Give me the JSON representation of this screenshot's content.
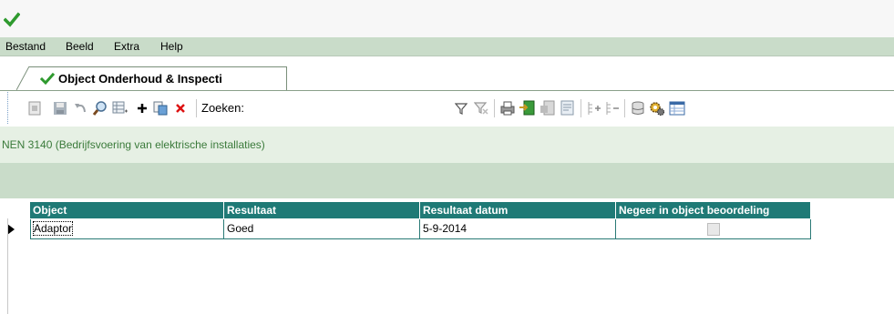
{
  "menu": {
    "items": [
      "Bestand",
      "Beeld",
      "Extra",
      "Help"
    ]
  },
  "tab": {
    "label": "Object Onderhoud & Inspecti"
  },
  "toolbar": {
    "search_label": "Zoeken:",
    "search_value": ""
  },
  "section": {
    "title": "NEN 3140 (Bedrijfsvoering van elektrische installaties)"
  },
  "grid": {
    "columns": [
      "Object",
      "Resultaat",
      "Resultaat datum",
      "Negeer in object beoordeling"
    ],
    "rows": [
      {
        "object": "Adaptor",
        "resultaat": "Goed",
        "datum": "5-9-2014",
        "negeer": false
      }
    ]
  },
  "icons": {
    "app": "green-check-logo-icon",
    "toolbar": [
      "new-record-icon",
      "save-icon",
      "undo-icon",
      "search-icon",
      "grid-export-icon",
      "add-icon",
      "copy-icon",
      "delete-icon",
      "filter-icon",
      "clear-filter-icon",
      "print-icon",
      "import-icon",
      "export-icon",
      "report-icon",
      "expand-icon",
      "collapse-icon",
      "database-icon",
      "settings-gear-icon",
      "table-icon"
    ]
  },
  "colors": {
    "menu_bg": "#c9dcc9",
    "grid_header": "#1f7a76",
    "section_text": "#3a7a3a",
    "accent_green": "#2e8b2e"
  }
}
